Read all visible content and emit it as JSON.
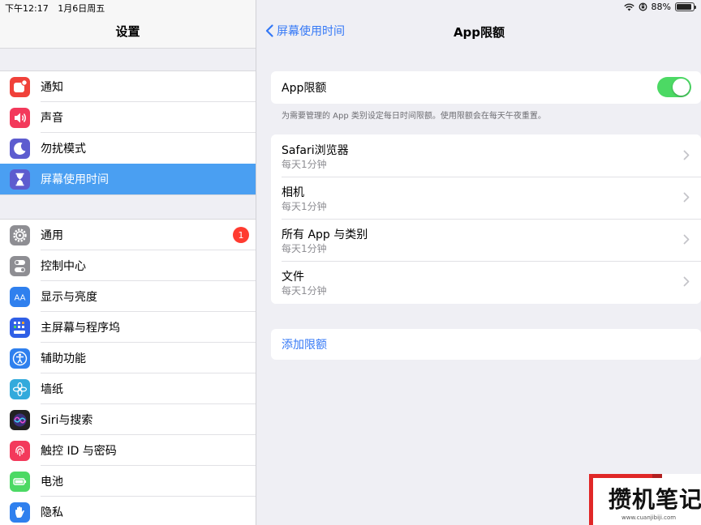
{
  "status_bar": {
    "time": "下午12:17",
    "date": "1月6日周五",
    "battery": "88%",
    "battery_level": 0.88
  },
  "sidebar": {
    "title": "设置",
    "group1": [
      {
        "label": "通知",
        "icon": "notifications-icon",
        "color": "#f0413a"
      },
      {
        "label": "声音",
        "icon": "speaker-icon",
        "color": "#f3395b"
      },
      {
        "label": "勿扰模式",
        "icon": "moon-icon",
        "color": "#5d5ccf"
      },
      {
        "label": "屏幕使用时间",
        "icon": "hourglass-icon",
        "color": "#5d5ccf",
        "selected": true
      }
    ],
    "group2": [
      {
        "label": "通用",
        "icon": "gear-icon",
        "color": "#8e8e93",
        "badge": "1"
      },
      {
        "label": "控制中心",
        "icon": "toggles-icon",
        "color": "#8e8e93"
      },
      {
        "label": "显示与亮度",
        "icon": "text-size-icon",
        "color": "#2f80ee",
        "glyph": "AA"
      },
      {
        "label": "主屏幕与程序坞",
        "icon": "app-grid-icon",
        "color": "#2f5fe6"
      },
      {
        "label": "辅助功能",
        "icon": "accessibility-icon",
        "color": "#2f80ee"
      },
      {
        "label": "墙纸",
        "icon": "flower-icon",
        "color": "#32aadc"
      },
      {
        "label": "Siri与搜索",
        "icon": "siri-icon",
        "color": "#222222"
      },
      {
        "label": "触控 ID 与密码",
        "icon": "fingerprint-icon",
        "color": "#f3395b"
      },
      {
        "label": "电池",
        "icon": "battery-icon",
        "color": "#4cd964"
      },
      {
        "label": "隐私",
        "icon": "hand-icon",
        "color": "#2f80ee"
      }
    ]
  },
  "detail": {
    "back_label": "屏幕使用时间",
    "title": "App限额",
    "toggle_label": "App限额",
    "toggle_on": true,
    "description": "为需要管理的 App 类别设定每日时间限额。使用限额会在每天午夜重置。",
    "items": [
      {
        "title": "Safari浏览器",
        "subtitle": "每天1分钟"
      },
      {
        "title": "相机",
        "subtitle": "每天1分钟"
      },
      {
        "title": "所有 App 与类别",
        "subtitle": "每天1分钟"
      },
      {
        "title": "文件",
        "subtitle": "每天1分钟"
      }
    ],
    "add_label": "添加限额"
  },
  "watermark": {
    "text": "攒机笔记",
    "url": "www.cuanjibiji.com"
  },
  "colors": {
    "accent": "#3478f6",
    "selected_row": "#4a9ff2",
    "switch_on": "#4cd964",
    "badge": "#ff3b30"
  }
}
